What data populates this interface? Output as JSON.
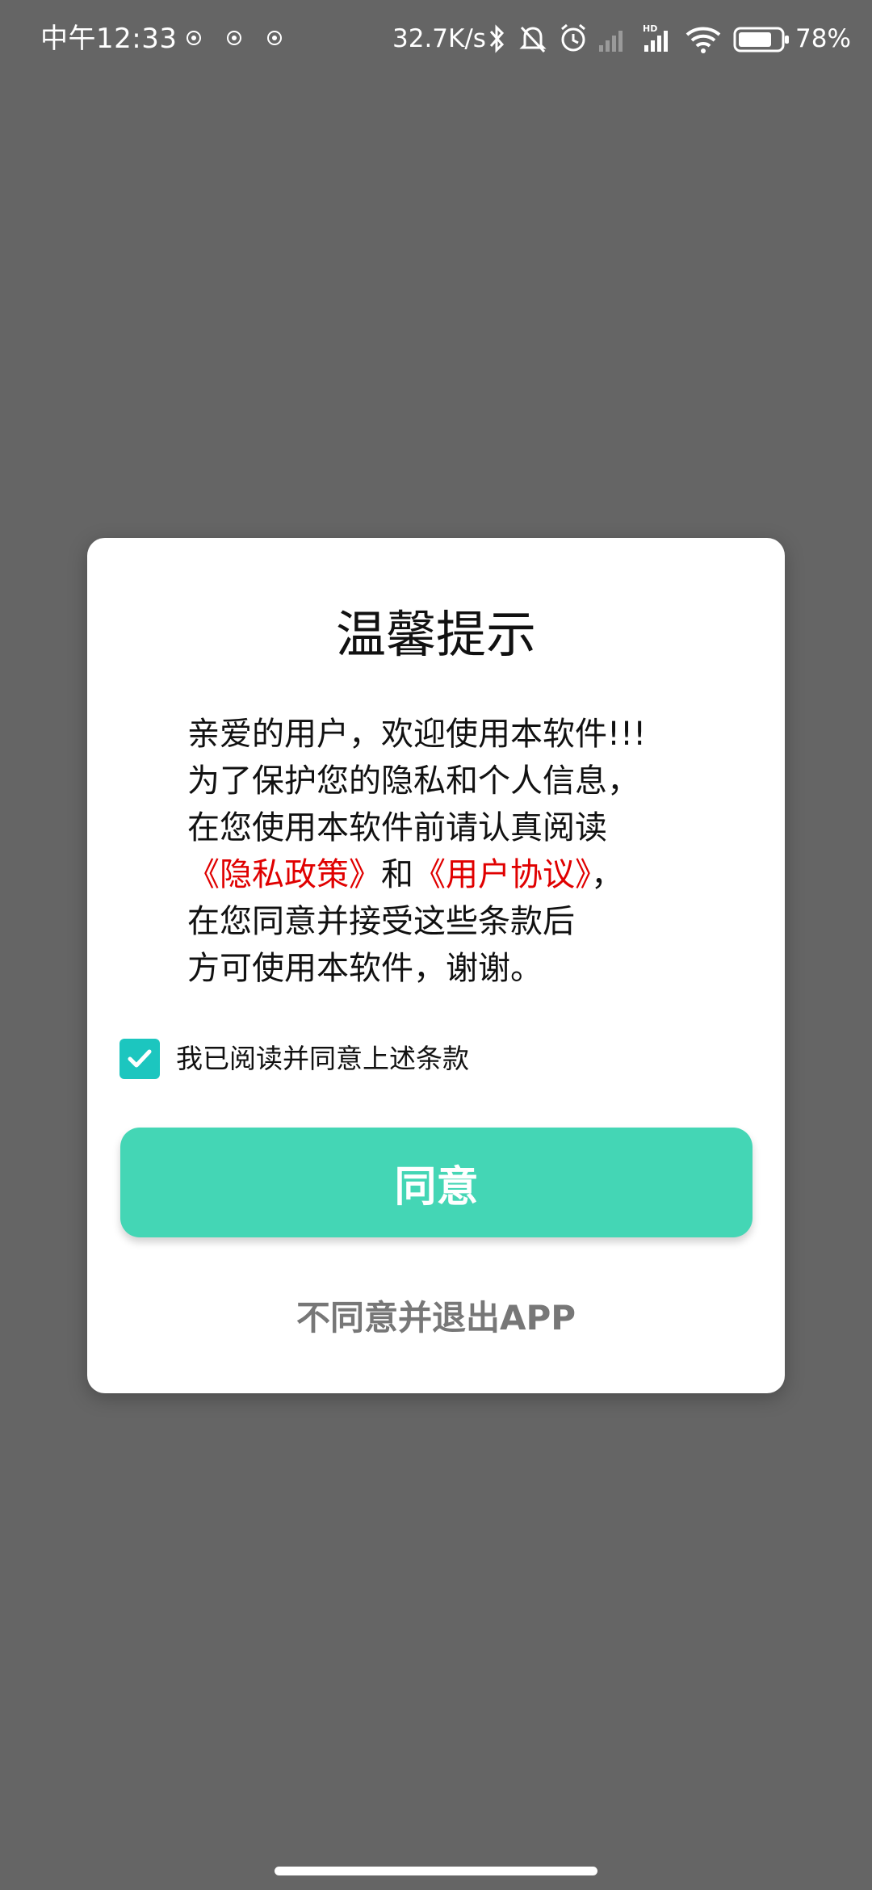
{
  "status_bar": {
    "time": "中午12:33",
    "net_speed": "32.7K/s",
    "battery_percent": "78%",
    "icons": [
      "notification-icon",
      "bluetooth-icon",
      "mute-icon",
      "alarm-icon",
      "signal-icon",
      "hd-icon",
      "wifi-icon",
      "battery-icon"
    ]
  },
  "dialog": {
    "title": "温馨提示",
    "lines": [
      "亲爱的用户，欢迎使用本软件!!!",
      "为了保护您的隐私和个人信息，",
      "在您使用本软件前请认真阅读"
    ],
    "link_privacy": "《隐私政策》",
    "link_and": "和",
    "link_terms": "《用户协议》",
    "link_after": "，",
    "line5": "在您同意并接受这些条款后",
    "line6": "方可使用本软件，谢谢。",
    "checkbox_label": "我已阅读并同意上述条款",
    "agree_button": "同意",
    "exit_link": "不同意并退出APP"
  },
  "colors": {
    "background": "#656565",
    "accent_button": "#44d6b5",
    "checkbox": "#1cc6bf",
    "link": "#e00000"
  }
}
